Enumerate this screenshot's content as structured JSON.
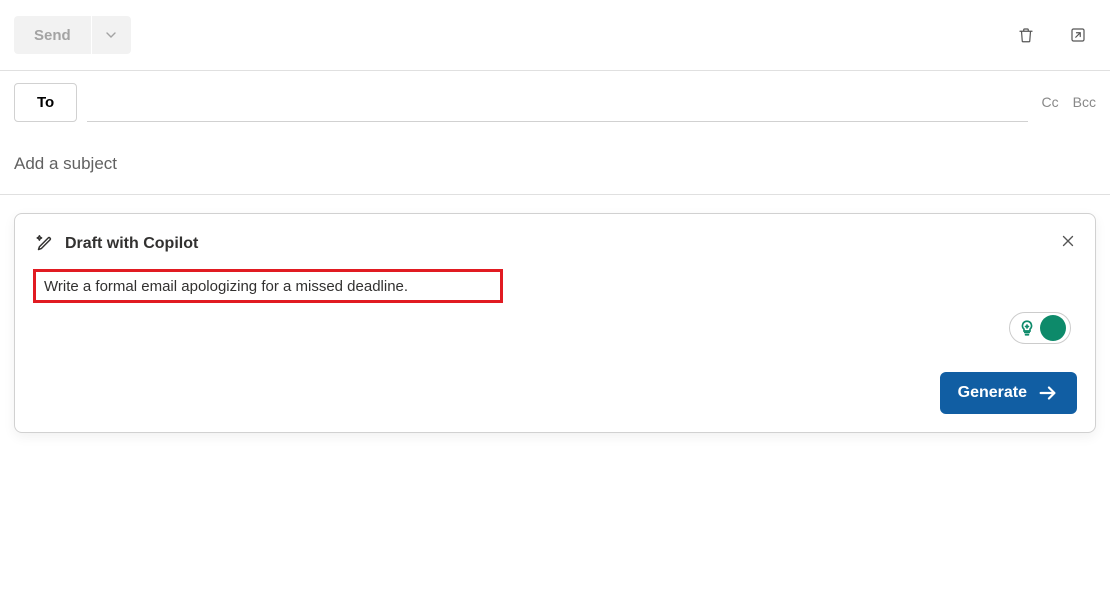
{
  "toolbar": {
    "send_label": "Send"
  },
  "recipients": {
    "to_label": "To",
    "cc_label": "Cc",
    "bcc_label": "Bcc",
    "to_value": ""
  },
  "subject": {
    "placeholder": "Add a subject",
    "value": ""
  },
  "copilot": {
    "title": "Draft with Copilot",
    "prompt_text": "Write a formal email apologizing for a missed deadline.",
    "generate_label": "Generate"
  }
}
